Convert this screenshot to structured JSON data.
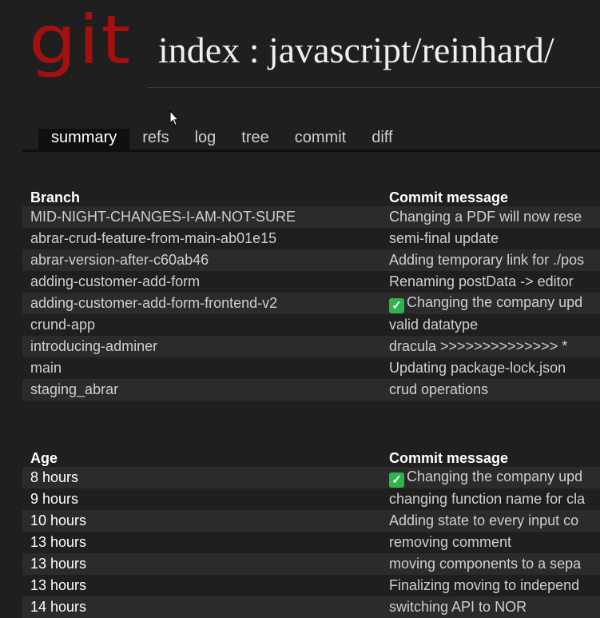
{
  "header": {
    "logo_text": "git",
    "repo_title": "index : javascript/reinhard/"
  },
  "tabs": [
    {
      "label": "summary",
      "active": true
    },
    {
      "label": "refs"
    },
    {
      "label": "log"
    },
    {
      "label": "tree"
    },
    {
      "label": "commit"
    },
    {
      "label": "diff"
    }
  ],
  "branches": {
    "col_branch": "Branch",
    "col_message": "Commit message",
    "rows": [
      {
        "name": "MID-NIGHT-CHANGES-I-AM-NOT-SURE",
        "message": "Changing a PDF will now rese"
      },
      {
        "name": "abrar-crud-feature-from-main-ab01e15",
        "message": "semi-final update"
      },
      {
        "name": "abrar-version-after-c60ab46",
        "message": "Adding temporary link for ./pos"
      },
      {
        "name": "adding-customer-add-form",
        "message": "Renaming postData -> editor"
      },
      {
        "name": "adding-customer-add-form-frontend-v2",
        "message": "Changing the company upd",
        "check": true
      },
      {
        "name": "crund-app",
        "message": "valid datatype"
      },
      {
        "name": "introducing-adminer",
        "message": "dracula >>>>>>>>>>>>>> *"
      },
      {
        "name": "main",
        "message": "Updating package-lock.json"
      },
      {
        "name": "staging_abrar",
        "message": "crud operations"
      }
    ]
  },
  "commits": {
    "col_age": "Age",
    "col_message": "Commit message",
    "rows": [
      {
        "age": "8 hours",
        "message": "Changing the company upd",
        "check": true
      },
      {
        "age": "9 hours",
        "message": "changing function name for cla"
      },
      {
        "age": "10 hours",
        "message": "Adding state to every input co"
      },
      {
        "age": "13 hours",
        "message": "removing comment"
      },
      {
        "age": "13 hours",
        "message": "moving components to a sepa"
      },
      {
        "age": "13 hours",
        "message": "Finalizing moving to independ"
      },
      {
        "age": "14 hours",
        "message": "switching API to NOR"
      }
    ]
  },
  "colors": {
    "background": "#1f1f1f",
    "row_alt": "#2b2b2b",
    "logo": "#a40f0f",
    "check": "#2fb34b"
  }
}
